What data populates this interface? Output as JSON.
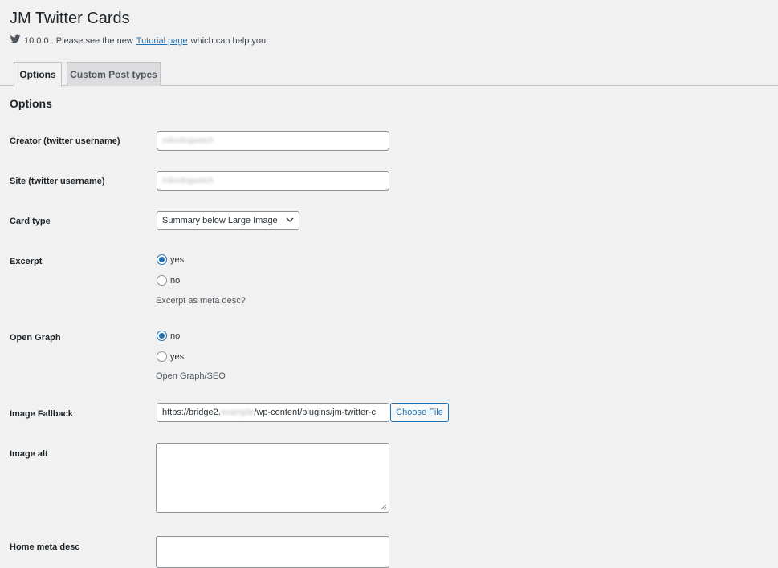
{
  "header": {
    "title": "JM Twitter Cards",
    "version_text": "10.0.0 : Please see the new",
    "tutorial_link": "Tutorial page",
    "after_link_text": "which can help you."
  },
  "tabs": [
    {
      "label": "Options",
      "active": true
    },
    {
      "label": "Custom Post types",
      "active": false
    }
  ],
  "section": {
    "title": "Options"
  },
  "fields": {
    "creator": {
      "label": "Creator (twitter username)",
      "value": "mikodogwatch"
    },
    "site": {
      "label": "Site (twitter username)",
      "value": "mikodogwatch"
    },
    "card_type": {
      "label": "Card type",
      "selected": "Summary below Large Image"
    },
    "excerpt": {
      "label": "Excerpt",
      "options": [
        {
          "label": "yes",
          "checked": true
        },
        {
          "label": "no",
          "checked": false
        }
      ],
      "description": "Excerpt as meta desc?"
    },
    "open_graph": {
      "label": "Open Graph",
      "options": [
        {
          "label": "no",
          "checked": true
        },
        {
          "label": "yes",
          "checked": false
        }
      ],
      "description": "Open Graph/SEO"
    },
    "image_fallback": {
      "label": "Image Fallback",
      "value_prefix": "https://bridge2.",
      "value_blurred": "example",
      "value_suffix": "/wp-content/plugins/jm-twitter-c",
      "button": "Choose File"
    },
    "image_alt": {
      "label": "Image alt",
      "value": ""
    },
    "home_meta_desc": {
      "label": "Home meta desc",
      "value": ""
    }
  },
  "colors": {
    "accent": "#2271b1",
    "background": "#f1f1f1",
    "twitter_icon": "#50575e"
  },
  "icons": {
    "twitter": "twitter-bird-icon",
    "dropdown": "chevron-down-icon"
  }
}
